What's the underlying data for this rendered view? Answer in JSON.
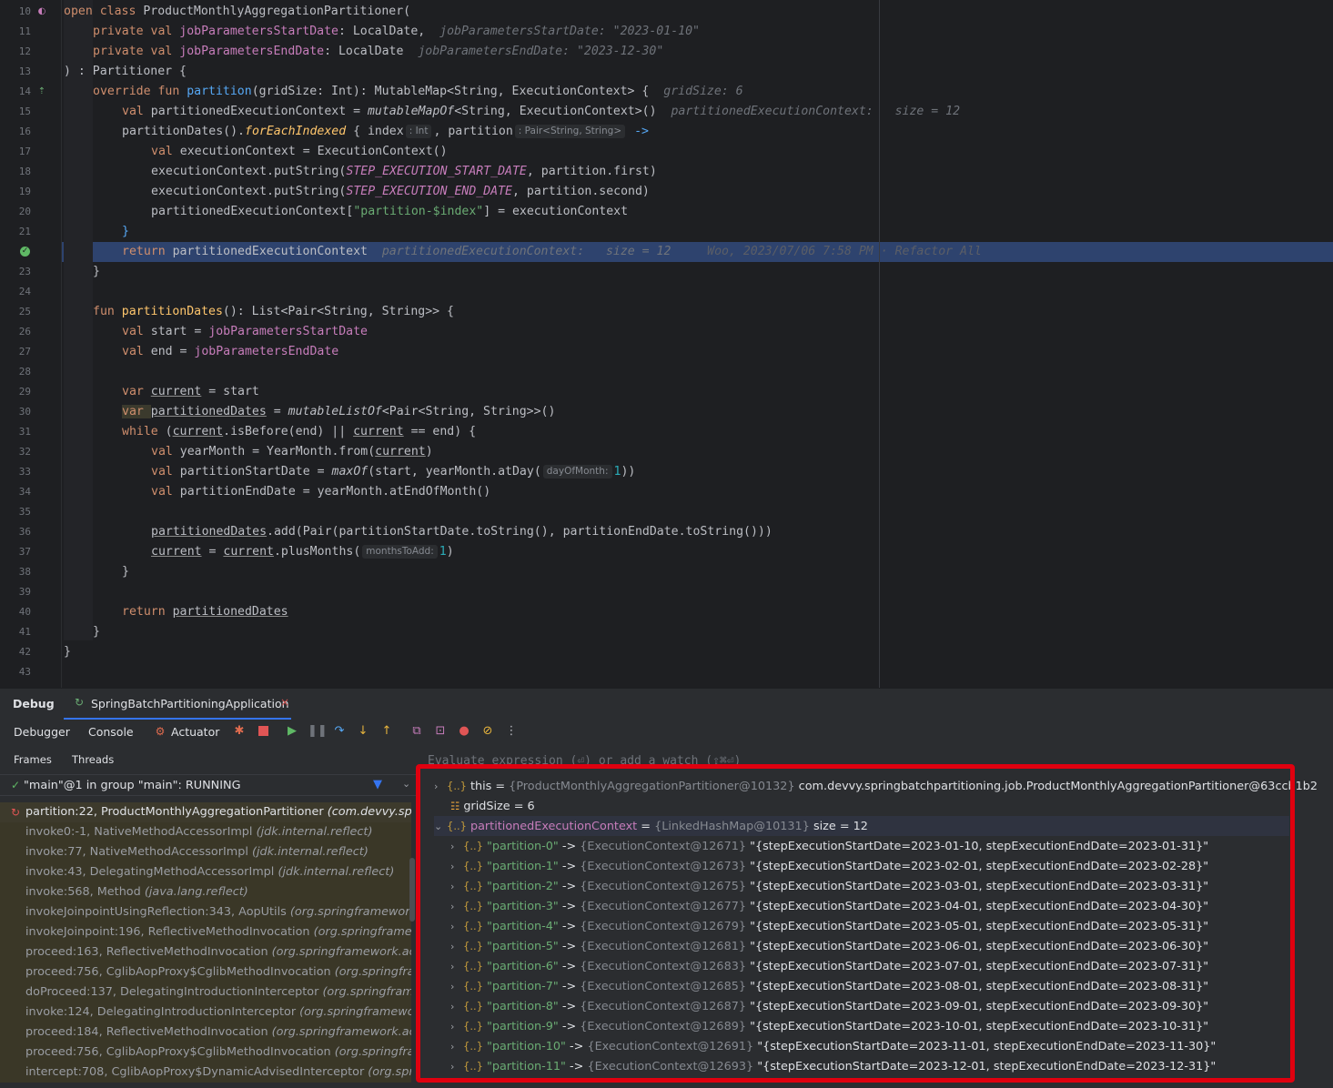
{
  "editor": {
    "lines": [
      {
        "n": "10"
      },
      {
        "n": "11"
      },
      {
        "n": "12"
      },
      {
        "n": "13"
      },
      {
        "n": "14"
      },
      {
        "n": "15"
      },
      {
        "n": "16"
      },
      {
        "n": "17"
      },
      {
        "n": "18"
      },
      {
        "n": "19"
      },
      {
        "n": "20"
      },
      {
        "n": "21"
      },
      {
        "n": ""
      },
      {
        "n": "23"
      },
      {
        "n": "24"
      },
      {
        "n": "25"
      },
      {
        "n": "26"
      },
      {
        "n": "27"
      },
      {
        "n": "28"
      },
      {
        "n": "29"
      },
      {
        "n": "30"
      },
      {
        "n": "31"
      },
      {
        "n": "32"
      },
      {
        "n": "33"
      },
      {
        "n": "34"
      },
      {
        "n": "35"
      },
      {
        "n": "36"
      },
      {
        "n": "37"
      },
      {
        "n": "38"
      },
      {
        "n": "39"
      },
      {
        "n": "40"
      },
      {
        "n": "41"
      },
      {
        "n": "42"
      },
      {
        "n": "43"
      }
    ],
    "tokens": {
      "open_class": "open class ",
      "class_name": "ProductMonthlyAggregationPartitioner(",
      "private_val": "private val ",
      "p_start": "jobParametersStartDate",
      "p_start_type": ": LocalDate,",
      "p_start_hint": "jobParametersStartDate: \"2023-01-10\"",
      "p_end": "jobParametersEndDate",
      "p_end_type": ": LocalDate",
      "p_end_hint": "jobParametersEndDate: \"2023-12-30\"",
      "close_partitioner": ") : Partitioner {",
      "override_fun": "override fun ",
      "partition_fn": "partition",
      "partition_sig": "(gridSize: Int): MutableMap<String, ExecutionContext> {",
      "grid_hint": "gridSize: 6",
      "val_kw": "val ",
      "pec_decl": "partitionedExecutionContext = ",
      "mutable_map": "mutableMapOf",
      "mutable_map_rest": "<String, ExecutionContext>()",
      "pec_hint": "partitionedExecutionContext:   size = 12",
      "partition_dates_call": "partitionDates()",
      "dot": ".",
      "for_each_indexed": "forEachIndexed",
      "lambda_open": " { index",
      "int_hint": ": Int",
      "lambda_partition": ", partition",
      "pair_hint": ": Pair<String, String>",
      "arrow": "->",
      "ec_decl": "executionContext = ExecutionContext()",
      "put_string_open": "executionContext.putString(",
      "start_const": "STEP_EXECUTION_START_DATE",
      "start_rest": ", partition.first)",
      "end_const": "STEP_EXECUTION_END_DATE",
      "end_rest": ", partition.second)",
      "pec_index_open": "partitionedExecutionContext[",
      "partition_str": "\"partition-$index\"",
      "pec_index_rest": "] = executionContext",
      "close_brace": "}",
      "return_kw": "return ",
      "return_pec": "partitionedExecutionContext",
      "return_hint": "partitionedExecutionContext:   size = 12",
      "blame": "Woo, 2023/07/06 7:58 PM · Refactor All",
      "fun_kw": "fun ",
      "partition_dates_fn": "partitionDates",
      "partition_dates_sig": "(): List<Pair<String, String>> {",
      "start_decl": "start = ",
      "end_decl": "end = ",
      "var_kw": "var ",
      "current": "current",
      "eq_start": " = start",
      "partitioned_dates": "partitionedDates",
      "eq": " = ",
      "mutable_list": "mutableListOf",
      "mutable_list_rest": "<Pair<String, String>>()",
      "while_kw": "while ",
      "paren_open": "(",
      "is_before": ".isBefore(end) || ",
      "eq_end": " == end) {",
      "ym_decl": "yearMonth = YearMonth.from(",
      "paren_close": ")",
      "psd_decl": "partitionStartDate = ",
      "max_of": "maxOf",
      "max_of_args": "(start, yearMonth.atDay(",
      "day_hint": "dayOfMonth:",
      "one": "1",
      "double_close": "))",
      "ped_decl": "partitionEndDate = yearMonth.atEndOfMonth()",
      "add_rest": ".add(Pair(partitionStartDate.toString(), partitionEndDate.toString()))",
      "plus_months": ".plusMonths(",
      "months_hint": "monthsToAdd:"
    }
  },
  "debug": {
    "title": "Debug",
    "run_config": "SpringBatchPartitioningApplication",
    "tabs": [
      "Debugger",
      "Console",
      "Actuator"
    ],
    "frame_tabs": [
      "Frames",
      "Threads"
    ],
    "thread": "\"main\"@1 in group \"main\": RUNNING",
    "frames": [
      {
        "method": "partition:22, ProductMonthlyAggregationPartitioner",
        "pkg": "(com.devvy.springbatchpartitioning.job)"
      },
      {
        "method": "invoke0:-1, NativeMethodAccessorImpl",
        "pkg": "(jdk.internal.reflect)"
      },
      {
        "method": "invoke:77, NativeMethodAccessorImpl",
        "pkg": "(jdk.internal.reflect)"
      },
      {
        "method": "invoke:43, DelegatingMethodAccessorImpl",
        "pkg": "(jdk.internal.reflect)"
      },
      {
        "method": "invoke:568, Method",
        "pkg": "(java.lang.reflect)"
      },
      {
        "method": "invokeJoinpointUsingReflection:343, AopUtils",
        "pkg": "(org.springframework.aop.support)"
      },
      {
        "method": "invokeJoinpoint:196, ReflectiveMethodInvocation",
        "pkg": "(org.springframework.aop)"
      },
      {
        "method": "proceed:163, ReflectiveMethodInvocation",
        "pkg": "(org.springframework.aop.framework)"
      },
      {
        "method": "proceed:756, CglibAopProxy$CglibMethodInvocation",
        "pkg": "(org.springframework.aop)"
      },
      {
        "method": "doProceed:137, DelegatingIntroductionInterceptor",
        "pkg": "(org.springframework.aop)"
      },
      {
        "method": "invoke:124, DelegatingIntroductionInterceptor",
        "pkg": "(org.springframework.aop)"
      },
      {
        "method": "proceed:184, ReflectiveMethodInvocation",
        "pkg": "(org.springframework.aop.framework)"
      },
      {
        "method": "proceed:756, CglibAopProxy$CglibMethodInvocation",
        "pkg": "(org.springframework.aop)"
      },
      {
        "method": "intercept:708, CglibAopProxy$DynamicAdvisedInterceptor",
        "pkg": "(org.springframework.aop)"
      }
    ],
    "eval_placeholder": "Evaluate expression (⏎) or add a watch (⇧⌘⏎)",
    "vars": {
      "this": {
        "name": "this",
        "ref": "{ProductMonthlyAggregationPartitioner@10132}",
        "value": "com.devvy.springbatchpartitioning.job.ProductMonthlyAggregationPartitioner@63ccb1b2"
      },
      "grid": {
        "name": "gridSize",
        "value": "= 6"
      },
      "pec": {
        "name": "partitionedExecutionContext",
        "ref": "{LinkedHashMap@10131}",
        "value": "size = 12"
      },
      "partitions": [
        {
          "key": "\"partition-0\"",
          "ref": "{ExecutionContext@12671}",
          "value": "\"{stepExecutionStartDate=2023-01-10, stepExecutionEndDate=2023-01-31}\""
        },
        {
          "key": "\"partition-1\"",
          "ref": "{ExecutionContext@12673}",
          "value": "\"{stepExecutionStartDate=2023-02-01, stepExecutionEndDate=2023-02-28}\""
        },
        {
          "key": "\"partition-2\"",
          "ref": "{ExecutionContext@12675}",
          "value": "\"{stepExecutionStartDate=2023-03-01, stepExecutionEndDate=2023-03-31}\""
        },
        {
          "key": "\"partition-3\"",
          "ref": "{ExecutionContext@12677}",
          "value": "\"{stepExecutionStartDate=2023-04-01, stepExecutionEndDate=2023-04-30}\""
        },
        {
          "key": "\"partition-4\"",
          "ref": "{ExecutionContext@12679}",
          "value": "\"{stepExecutionStartDate=2023-05-01, stepExecutionEndDate=2023-05-31}\""
        },
        {
          "key": "\"partition-5\"",
          "ref": "{ExecutionContext@12681}",
          "value": "\"{stepExecutionStartDate=2023-06-01, stepExecutionEndDate=2023-06-30}\""
        },
        {
          "key": "\"partition-6\"",
          "ref": "{ExecutionContext@12683}",
          "value": "\"{stepExecutionStartDate=2023-07-01, stepExecutionEndDate=2023-07-31}\""
        },
        {
          "key": "\"partition-7\"",
          "ref": "{ExecutionContext@12685}",
          "value": "\"{stepExecutionStartDate=2023-08-01, stepExecutionEndDate=2023-08-31}\""
        },
        {
          "key": "\"partition-8\"",
          "ref": "{ExecutionContext@12687}",
          "value": "\"{stepExecutionStartDate=2023-09-01, stepExecutionEndDate=2023-09-30}\""
        },
        {
          "key": "\"partition-9\"",
          "ref": "{ExecutionContext@12689}",
          "value": "\"{stepExecutionStartDate=2023-10-01, stepExecutionEndDate=2023-10-31}\""
        },
        {
          "key": "\"partition-10\"",
          "ref": "{ExecutionContext@12691}",
          "value": "\"{stepExecutionStartDate=2023-11-01, stepExecutionEndDate=2023-11-30}\""
        },
        {
          "key": "\"partition-11\"",
          "ref": "{ExecutionContext@12693}",
          "value": "\"{stepExecutionStartDate=2023-12-01, stepExecutionEndDate=2023-12-31}\""
        }
      ]
    }
  },
  "icons": {
    "breakpoint": "breakpoint-icon",
    "stop": "stop-icon",
    "resume": "resume-icon",
    "pause": "pause-icon",
    "step_over": "step-over-icon",
    "step_into": "step-into-icon",
    "step_out": "step-out-icon"
  }
}
